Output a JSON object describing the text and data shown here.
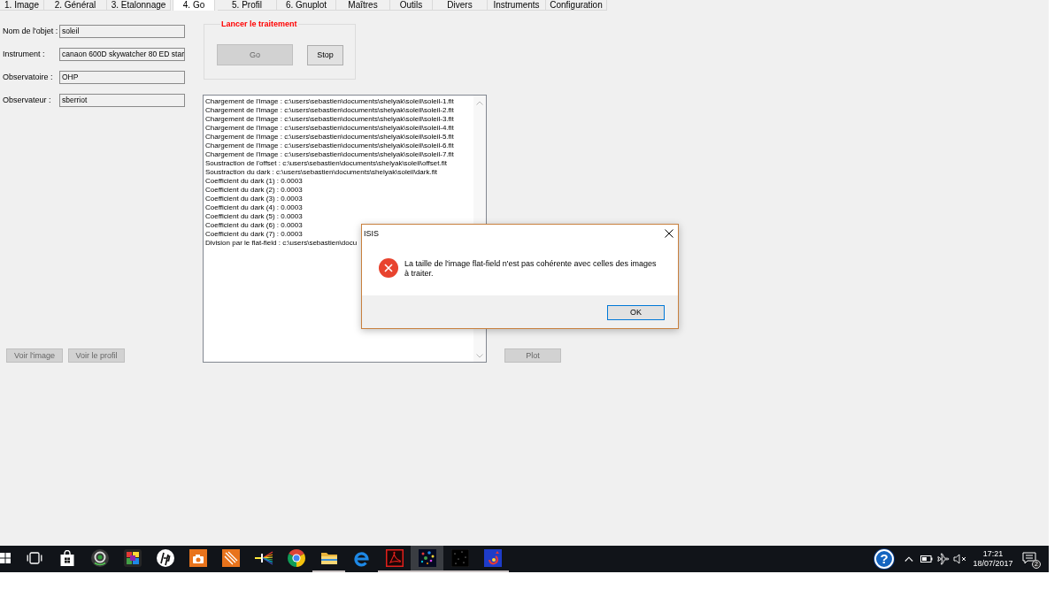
{
  "tabs": [
    {
      "label": "1. Image",
      "selected": false
    },
    {
      "label": "2. Général",
      "selected": false
    },
    {
      "label": "3. Etalonnage",
      "selected": false
    },
    {
      "label": "4. Go",
      "selected": true
    },
    {
      "label": "5. Profil",
      "selected": false
    },
    {
      "label": "6. Gnuplot",
      "selected": false
    },
    {
      "label": "Maîtres",
      "selected": false
    },
    {
      "label": "Outils",
      "selected": false
    },
    {
      "label": "Divers",
      "selected": false
    },
    {
      "label": "Instruments",
      "selected": false
    },
    {
      "label": "Configuration",
      "selected": false
    }
  ],
  "object_form": {
    "fields": [
      {
        "label": "Nom de l'objet :",
        "value": "soleil"
      },
      {
        "label": "Instrument :",
        "value": "canaon 600D skywatcher 80 ED star"
      },
      {
        "label": "Observatoire :",
        "value": "OHP"
      },
      {
        "label": "Observateur :",
        "value": "sberriot"
      }
    ]
  },
  "processing": {
    "title": "Lancer le traitement",
    "buttons": [
      {
        "label": "Go",
        "disabled": true
      },
      {
        "label": "Stop",
        "disabled": false
      }
    ]
  },
  "log": {
    "lines": [
      "Chargement de l'image : c:\\users\\sebastien\\documents\\shelyak\\soleil\\soleil-1.fit",
      "Chargement de l'image : c:\\users\\sebastien\\documents\\shelyak\\soleil\\soleil-2.fit",
      "Chargement de l'image : c:\\users\\sebastien\\documents\\shelyak\\soleil\\soleil-3.fit",
      "Chargement de l'image : c:\\users\\sebastien\\documents\\shelyak\\soleil\\soleil-4.fit",
      "Chargement de l'image : c:\\users\\sebastien\\documents\\shelyak\\soleil\\soleil-5.fit",
      "Chargement de l'image : c:\\users\\sebastien\\documents\\shelyak\\soleil\\soleil-6.fit",
      "Chargement de l'image : c:\\users\\sebastien\\documents\\shelyak\\soleil\\soleil-7.fit",
      "Soustraction de l'offset : c:\\users\\sebastien\\documents\\shelyak\\soleil\\offset.fit",
      "Soustraction du dark : c:\\users\\sebastien\\documents\\shelyak\\soleil\\dark.fit",
      "Coefficient du dark (1) : 0.0003",
      "Coefficient du dark (2) : 0.0003",
      "Coefficient du dark (3) : 0.0003",
      "Coefficient du dark (4) : 0.0003",
      "Coefficient du dark (5) : 0.0003",
      "Coefficient du dark (6) : 0.0003",
      "Coefficient du dark (7) : 0.0003",
      "Division par le flat-field : c:\\users\\sebastien\\docu"
    ]
  },
  "view_buttons": [
    {
      "label": "Voir l'image",
      "disabled": true
    },
    {
      "label": "Voir le profil",
      "disabled": true
    }
  ],
  "plot_button": {
    "label": "Plot",
    "disabled": true
  },
  "dialog": {
    "title": "ISIS",
    "message": "La taille de l'image flat-field n'est pas cohérente avec celles des images à traiter.",
    "ok_button": {
      "label": "OK",
      "focused": true
    }
  },
  "taskbar": {
    "apps": [
      {
        "kind": "start",
        "selected": false,
        "running": false
      },
      {
        "kind": "taskview",
        "selected": false,
        "running": false
      },
      {
        "kind": "bag",
        "selected": false,
        "running": false
      },
      {
        "kind": "webcam",
        "selected": false,
        "running": false
      },
      {
        "kind": "puzzle",
        "selected": false,
        "running": false
      },
      {
        "kind": "roundel",
        "selected": false,
        "running": false
      },
      {
        "kind": "camera",
        "selected": false,
        "running": false
      },
      {
        "kind": "brush",
        "selected": false,
        "running": false
      },
      {
        "kind": "prism",
        "selected": false,
        "running": false
      },
      {
        "kind": "wheel",
        "selected": false,
        "running": false
      },
      {
        "kind": "folder",
        "selected": false,
        "running": true
      },
      {
        "kind": "arc",
        "selected": false,
        "running": false
      },
      {
        "kind": "swirl",
        "selected": false,
        "running": true
      },
      {
        "kind": "dots",
        "selected": true,
        "running": true
      },
      {
        "kind": "starfield",
        "selected": false,
        "running": true
      },
      {
        "kind": "tile",
        "selected": false,
        "running": true
      }
    ],
    "tray": {
      "help_label": "?",
      "volume_muted": true,
      "time": "17:21",
      "date": "18/07/2017",
      "notification_count": "2"
    }
  }
}
